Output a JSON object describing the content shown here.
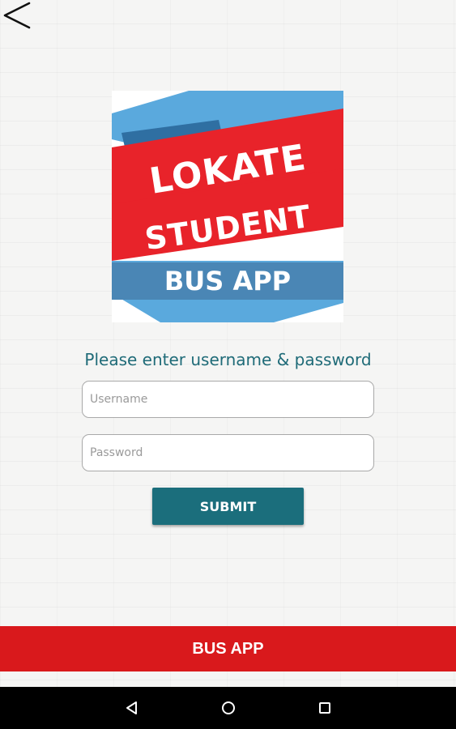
{
  "header": {
    "back_icon": "chevron-left-icon"
  },
  "logo": {
    "line1": "LOKATE",
    "line2": "STUDENT",
    "line3": "BUS APP",
    "colors": {
      "sky": "#5aa9dd",
      "ribbon": "#e8232a",
      "band": "#4a86b5",
      "text": "#ffffff"
    }
  },
  "login": {
    "prompt": "Please enter username & password",
    "username_placeholder": "Username",
    "password_placeholder": "Password",
    "submit_label": "SUBMIT"
  },
  "footer": {
    "label": "BUS APP"
  },
  "system_nav": {
    "back_icon": "nav-back-icon",
    "home_icon": "nav-home-icon",
    "recent_icon": "nav-recent-icon"
  },
  "colors": {
    "accent": "#1b6e7c",
    "footer_red": "#d9191c",
    "prompt_text": "#1f6b78"
  }
}
